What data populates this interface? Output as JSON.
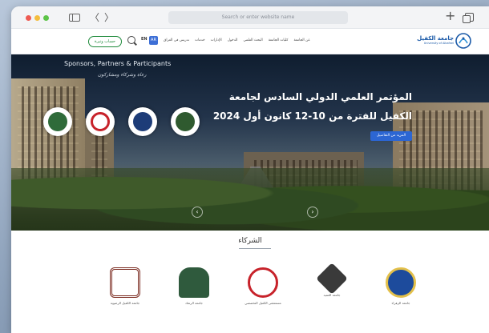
{
  "browser": {
    "address_placeholder": "Search or enter website name",
    "back_label": "〈",
    "forward_label": "〉",
    "new_tab_label": "+"
  },
  "site_header": {
    "login_label": "حساب وتيرة",
    "lang_en": "EN",
    "lang_ar": "AR",
    "nav_items": [
      "عن الجامعة",
      "كليات الجامعة",
      "البحث العلمي",
      "الدخول",
      "الإدارات",
      "خدمات",
      "تدريس في العراق"
    ],
    "logo_ar": "جامعة الكفيل",
    "logo_en": "University of Alkafeel"
  },
  "hero": {
    "sponsors_title": "Sponsors, Partners & Participants",
    "sponsors_subtitle": "رعاة وشركاء ومشاركون",
    "title_line1": "المؤتمر العلمي الدولي السادس لجامعة",
    "title_line2": "الكفيل للفترة من 10-12 كانون أول 2024",
    "cta_label": "المزيد من التفاصيل",
    "prev_label": "‹",
    "next_label": "›"
  },
  "partners": {
    "title": "الشركاء",
    "items": [
      {
        "name": "جامعة الكفيل الرضوية",
        "color": "#7a2a1f"
      },
      {
        "name": "جامعة الرشاد",
        "color": "#2f5a3d"
      },
      {
        "name": "مستشفى الكفيل التخصصي",
        "color": "#c7222a"
      },
      {
        "name": "جامعة العميد",
        "color": "#3a3a3a"
      },
      {
        "name": "جامعة الزهراء",
        "color": "#1d4b9c"
      }
    ]
  }
}
